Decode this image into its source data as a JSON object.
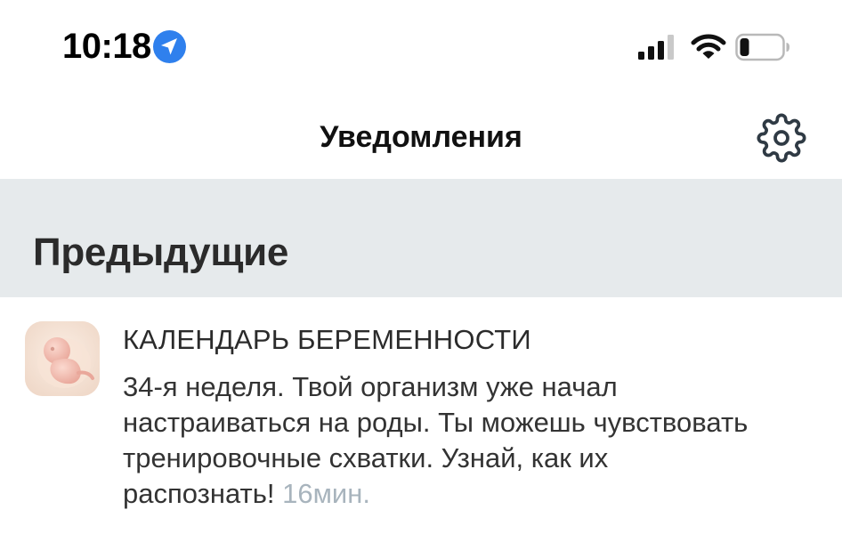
{
  "status_bar": {
    "time": "10:18",
    "icons": [
      "location-arrow-icon",
      "cellular-signal-icon",
      "wifi-icon",
      "battery-icon"
    ]
  },
  "nav": {
    "title": "Уведомления",
    "settings_icon": "gear-icon"
  },
  "section": {
    "title": "Предыдущие"
  },
  "notifications": [
    {
      "source": "КАЛЕНДАРЬ БЕРЕМЕННОСТИ",
      "body_lines": [
        "34-я неделя. Твой организм уже начал",
        "настраиваться на роды. Ты можешь чувствовать",
        "тренировочные схватки. Узнай, как их",
        "распознать!"
      ],
      "time": "16мин.",
      "icon": "fetus-icon"
    }
  ],
  "colors": {
    "accent_blue": "#2f80ed",
    "section_bg": "#e6eaec",
    "time_muted": "#a8b4bd"
  }
}
